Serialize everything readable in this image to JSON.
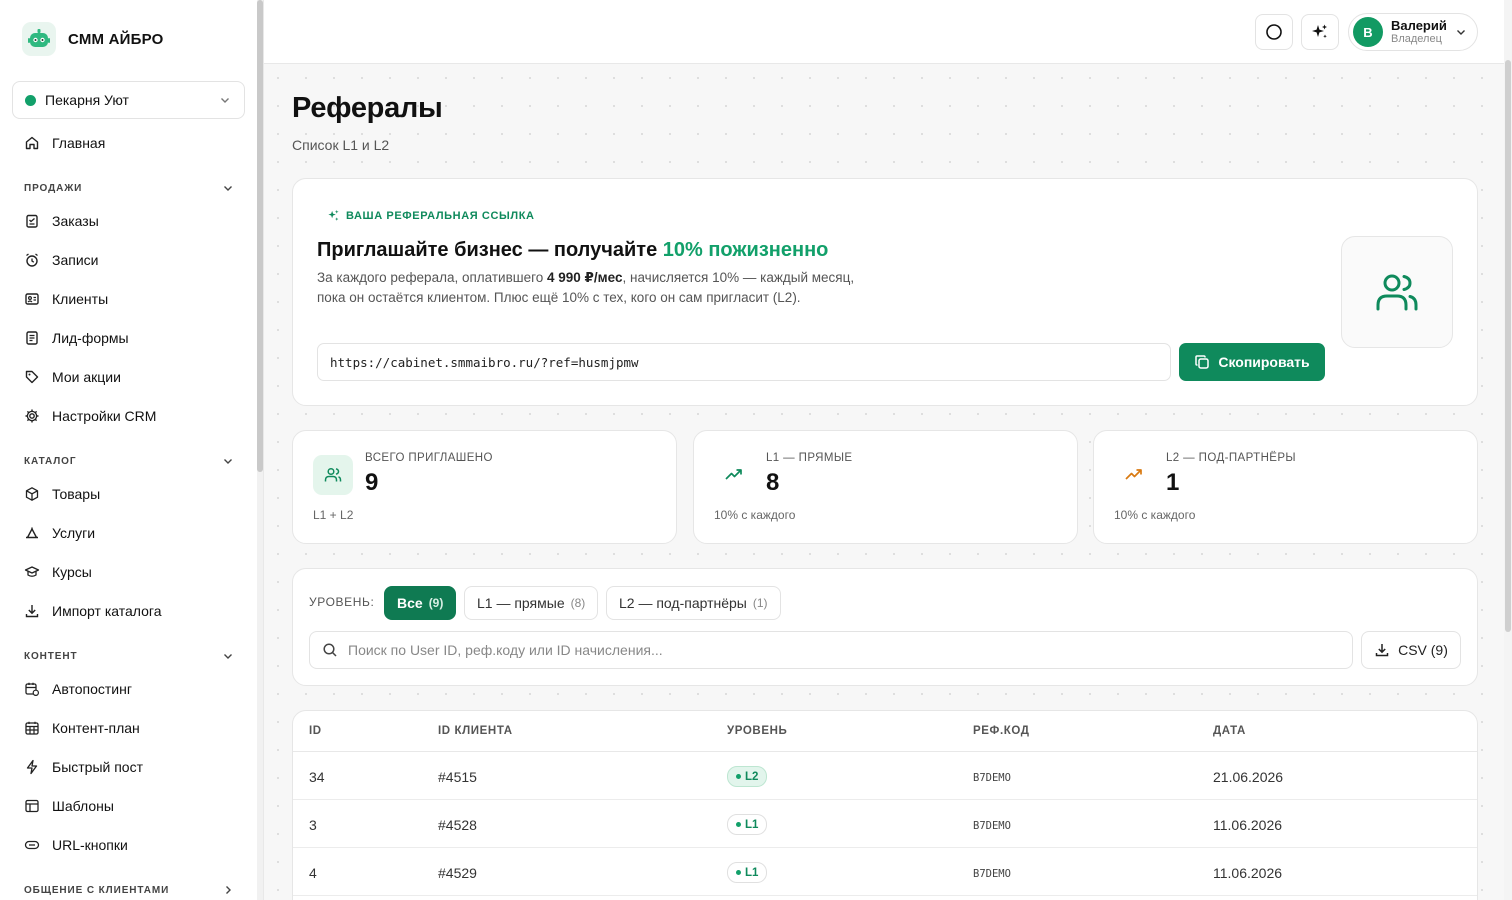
{
  "brand": {
    "name": "СММ АЙБРО"
  },
  "company": {
    "name": "Пекарня Уют"
  },
  "nav": {
    "home": "Главная",
    "sections": {
      "sales": "ПРОДАЖИ",
      "catalog": "КАТАЛОГ",
      "content": "КОНТЕНТ",
      "communication": "ОБЩЕНИЕ С КЛИЕНТАМИ"
    },
    "sales_items": [
      "Заказы",
      "Записи",
      "Клиенты",
      "Лид-формы",
      "Мои акции",
      "Настройки CRM"
    ],
    "catalog_items": [
      "Товары",
      "Услуги",
      "Курсы",
      "Импорт каталога"
    ],
    "content_items": [
      "Автопостинг",
      "Контент-план",
      "Быстрый пост",
      "Шаблоны",
      "URL-кнопки"
    ]
  },
  "user": {
    "initial": "В",
    "name": "Валерий",
    "role": "Владелец"
  },
  "page": {
    "title": "Рефералы",
    "subtitle": "Список L1 и L2"
  },
  "referral": {
    "tag": "ВАША РЕФЕРАЛЬНАЯ ССЫЛКА",
    "headline_main": "Приглашайте бизнес — получайте ",
    "headline_accent": "10% пожизненно",
    "desc_part1": "За каждого реферала, оплатившего ",
    "desc_bold": "4 990 ₽/мес",
    "desc_part2": ", начисляется 10% — каждый месяц, пока он остаётся клиентом. Плюс ещё 10% с тех, кого он сам пригласит (L2).",
    "link": "https://cabinet.smmaibro.ru/?ref=husmjpmw",
    "copy_label": "Скопировать"
  },
  "stats": [
    {
      "label": "ВСЕГО ПРИГЛАШЕНО",
      "value": "9",
      "foot": "L1 + L2"
    },
    {
      "label": "L1 — ПРЯМЫЕ",
      "value": "8",
      "foot": "10% с каждого"
    },
    {
      "label": "L2 — ПОД-ПАРТНЁРЫ",
      "value": "1",
      "foot": "10% с каждого"
    }
  ],
  "filters": {
    "label": "УРОВЕНЬ:",
    "chips": [
      {
        "label": "Все",
        "count": "(9)"
      },
      {
        "label": "L1 — прямые",
        "count": "(8)"
      },
      {
        "label": "L2 — под-партнёры",
        "count": "(1)"
      }
    ],
    "search_placeholder": "Поиск по User ID, реф.коду или ID начисления...",
    "csv_label": "CSV (9)"
  },
  "table": {
    "headers": [
      "ID",
      "ID КЛИЕНТА",
      "УРОВЕНЬ",
      "РЕФ.КОД",
      "ДАТА"
    ],
    "rows": [
      {
        "id": "34",
        "client": "#4515",
        "level": "L2",
        "code": "B7DEMO",
        "date": "21.06.2026"
      },
      {
        "id": "3",
        "client": "#4528",
        "level": "L1",
        "code": "B7DEMO",
        "date": "11.06.2026"
      },
      {
        "id": "4",
        "client": "#4529",
        "level": "L1",
        "code": "B7DEMO",
        "date": "11.06.2026"
      }
    ]
  },
  "colors": {
    "accent": "#0f8a5c",
    "accent_light": "#12a06a",
    "orange": "#d97a12"
  }
}
